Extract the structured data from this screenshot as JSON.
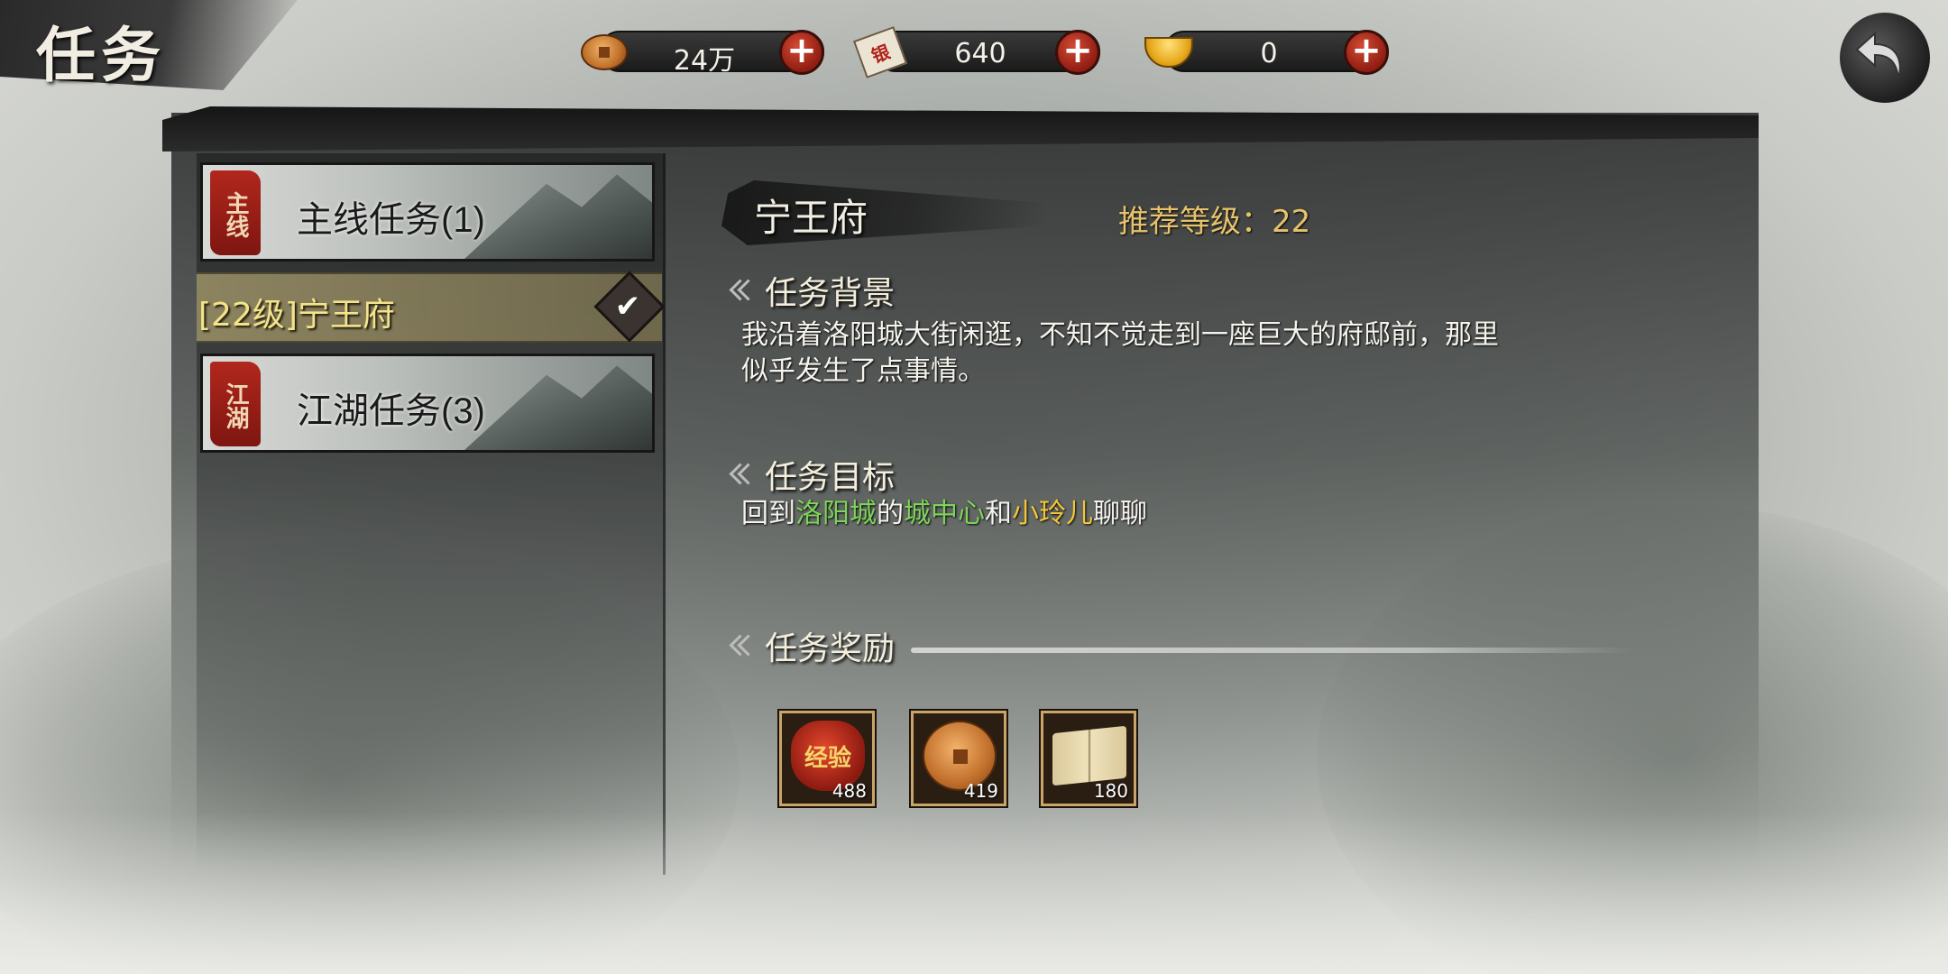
{
  "header": {
    "title": "任务",
    "currencies": [
      {
        "icon": "copper-coin-icon",
        "value": "24万",
        "add_label": "+"
      },
      {
        "icon": "ticket-icon",
        "value": "640",
        "add_label": "+",
        "icon_text": "银"
      },
      {
        "icon": "gold-ingot-icon",
        "value": "0",
        "add_label": "+"
      }
    ]
  },
  "categories": [
    {
      "seal": "主线",
      "label": "主线任务(1)"
    },
    {
      "seal": "江湖",
      "label": "江湖任务(3)"
    }
  ],
  "selected_quest": {
    "label": "[22级]宁王府"
  },
  "detail": {
    "place": "宁王府",
    "recommended_level": "推荐等级：22",
    "background_heading": "任务背景",
    "background_text_line1": "我沿着洛阳城大街闲逛，不知不觉走到一座巨大的府邸前，那里",
    "background_text_line2": "似乎发生了点事情。",
    "objective_heading": "任务目标",
    "objective": {
      "part1": "回到",
      "place": "洛阳城",
      "part2": "的",
      "spot": "城中心",
      "part3": "和",
      "npc": "小玲儿",
      "part4": "聊聊"
    },
    "reward_heading": "任务奖励",
    "rewards": [
      {
        "icon": "exp-bag-icon",
        "art_text": "经验",
        "count": "488"
      },
      {
        "icon": "copper-coin-icon",
        "count": "419"
      },
      {
        "icon": "book-icon",
        "count": "180"
      }
    ]
  },
  "colors": {
    "highlight_green": "#7ed35a",
    "highlight_yellow": "#f3c737",
    "level_gold": "#e6c26c"
  }
}
